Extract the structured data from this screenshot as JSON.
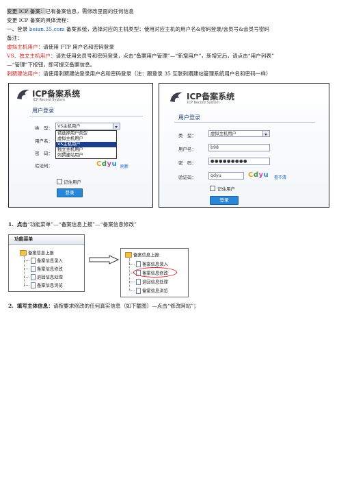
{
  "doc": {
    "l1_highlight": "变更 ICP 备案：",
    "l1_rest": "已有备案信息，需修改里面的任何信息",
    "l2": "变更 ICP 备案的具体流程：",
    "l3_a": "一、登录 ",
    "l3_link": "beian.35.com",
    "l3_b": " 备案系统，选择对应的主机类型：使用对应主机的用户名&密码登录/会员号&会员号密码",
    "l4": "备注：",
    "l5_red": "虚拟主机用户：",
    "l5_rest": "请使用 FTP 用户名和密码登录",
    "l6_red": "VS、独立主机用户：",
    "l6_rest": "请先使用会员号和密码登录，点击“备案用户管理”—“新增用户”，新增完后，请点击“用户列表”",
    "l7": "—“管理”下按钮，即可提交备案信息。",
    "l8_red": "刺猬建站用户：",
    "l8_rest": "请使用刺猬建站登录用户名和密码登录（注：跟登录 35 互联刺猬建站管理系统用户名和密码一样）",
    "step1_num": "1.",
    "step1_bold": "点击",
    "step1_rest": "“功能菜单”—“备案信息上报”—“备案信息修改”",
    "step2_num": "2.",
    "step2_bold": "填写主体信息：",
    "step2_rest": "请按要求修改的任何真实信息（如下截图）—点击“修改网站”；"
  },
  "login_left": {
    "title": "ICP备案系统",
    "subtitle": "ICP Record System",
    "section": "用户登录",
    "type_label": "类　型：",
    "type_value": "VS主机用户",
    "user_label": "用户名：",
    "pass_label": "密　码：",
    "code_label": "验证码：",
    "options": [
      "请选择用户类型",
      "虚拟主机用户",
      "VS主机用户",
      "独立主机用户",
      "刺猬建站用户"
    ],
    "captcha": "Cdyu",
    "refresh": "刷新",
    "remember": "记住用户",
    "login_btn": "登录"
  },
  "login_right": {
    "title": "ICP备案系统",
    "subtitle": "ICP Record System",
    "section": "用户登录",
    "type_label": "类　型：",
    "type_value": "虚拟主机用户",
    "user_label": "用户名：",
    "user_value": "b98",
    "pass_label": "密　码：",
    "pass_value": "●●●●●●●●●",
    "code_label": "验证码：",
    "code_value": "qdyu",
    "captcha": "Cdyu",
    "refresh": "看不清",
    "remember": "记住用户",
    "login_btn": "登录"
  },
  "menu_left": {
    "header": "功能菜单",
    "root": "备案信息上报",
    "items": [
      "备案信息录入",
      "备案信息修改",
      "退回信息处理",
      "备案信息浏览"
    ]
  },
  "menu_right": {
    "root": "备案信息上报",
    "items": [
      "备案信息录入",
      "备案信息修改",
      "退回信息处理",
      "备案信息浏览"
    ]
  },
  "colors": {
    "red_text": "#d42b2b",
    "link": "#1c5ebc",
    "highlight_bg": "#cfcfcf",
    "button_blue": "#2a86d6"
  }
}
